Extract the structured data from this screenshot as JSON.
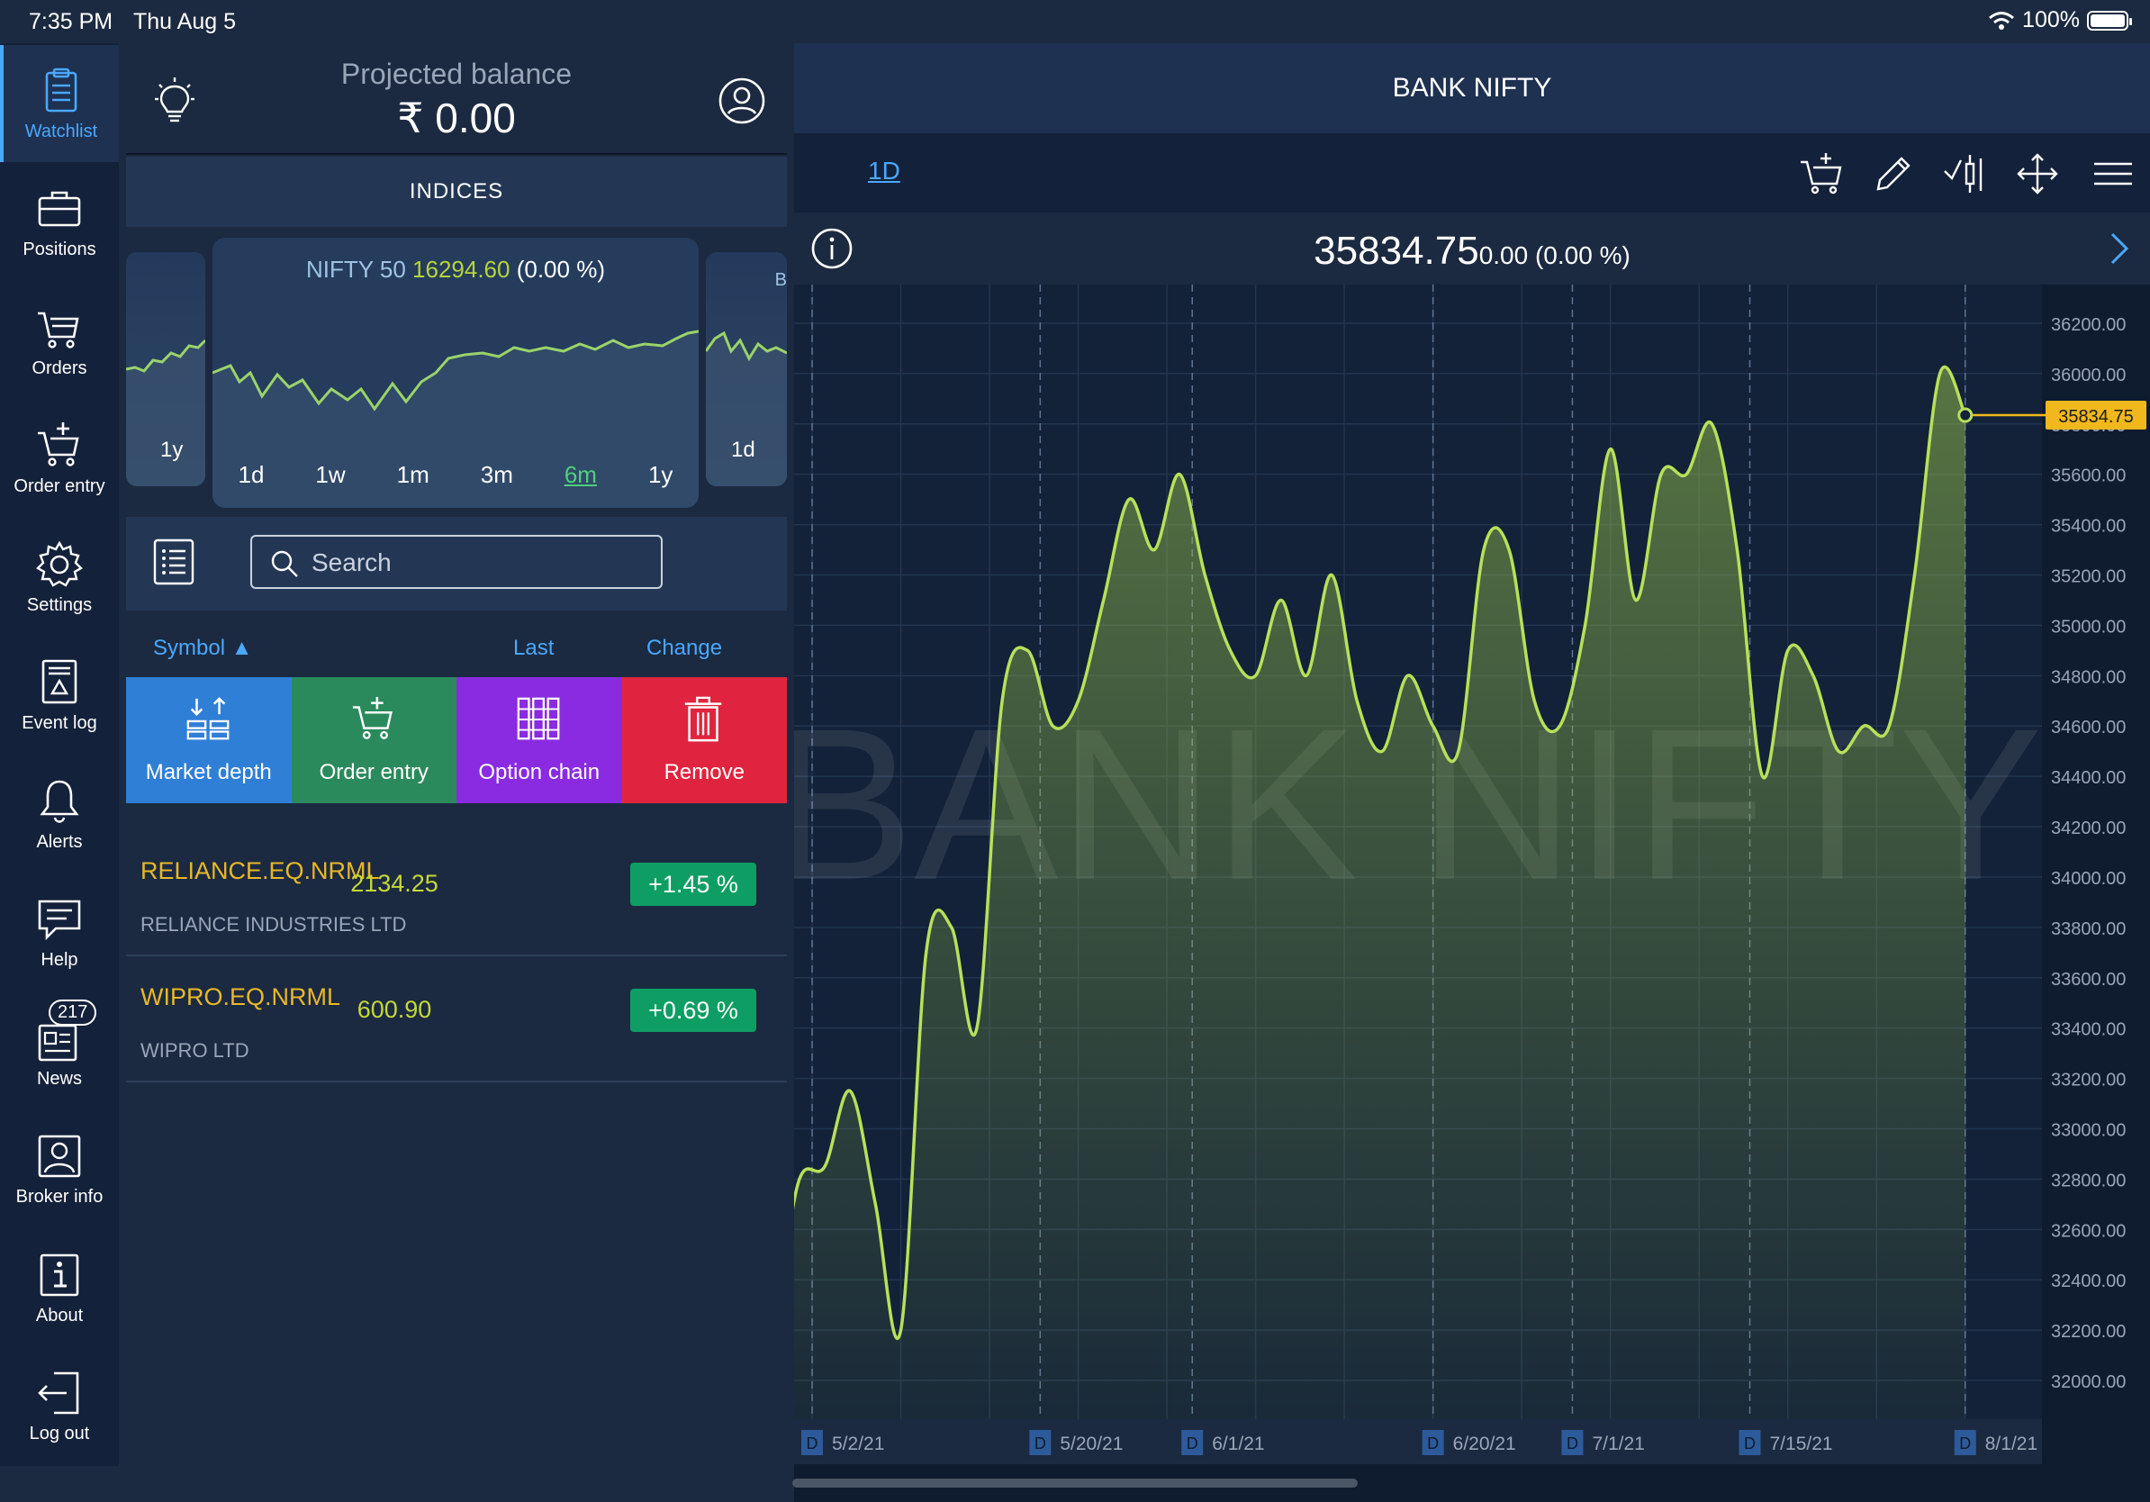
{
  "status_bar": {
    "time": "7:35 PM",
    "date": "Thu Aug 5",
    "battery": "100%"
  },
  "nav": [
    {
      "label": "Watchlist",
      "icon": "watchlist-icon",
      "active": true
    },
    {
      "label": "Positions",
      "icon": "briefcase-icon"
    },
    {
      "label": "Orders",
      "icon": "cart-icon"
    },
    {
      "label": "Order entry",
      "icon": "cart-plus-icon"
    },
    {
      "label": "Settings",
      "icon": "gear-icon"
    },
    {
      "label": "Event log",
      "icon": "event-log-icon"
    },
    {
      "label": "Alerts",
      "icon": "bell-icon"
    },
    {
      "label": "Help",
      "icon": "help-chat-icon"
    },
    {
      "label": "News",
      "icon": "news-icon",
      "badge": "217"
    },
    {
      "label": "Broker info",
      "icon": "broker-icon"
    },
    {
      "label": "About",
      "icon": "info-icon"
    },
    {
      "label": "Log out",
      "icon": "logout-icon"
    }
  ],
  "header": {
    "projected_label": "Projected balance",
    "projected_value": "₹ 0.00"
  },
  "indices": {
    "title": "INDICES",
    "left_card_range": "1y",
    "right_card_range": "1d",
    "right_card_title": "B",
    "main": {
      "name": "NIFTY 50",
      "value": "16294.60",
      "change": "(0.00 %)",
      "ranges": [
        "1d",
        "1w",
        "1m",
        "3m",
        "6m",
        "1y"
      ],
      "selected_range": "6m"
    }
  },
  "search": {
    "placeholder": "Search"
  },
  "columns": {
    "symbol": "Symbol ▲",
    "last": "Last",
    "change": "Change"
  },
  "actions": [
    {
      "label": "Market depth",
      "icon": "market-depth-icon",
      "color": "#2f7fd6"
    },
    {
      "label": "Order entry",
      "icon": "cart-plus-icon",
      "color": "#2b8a5c"
    },
    {
      "label": "Option chain",
      "icon": "option-chain-icon",
      "color": "#8a2be2"
    },
    {
      "label": "Remove",
      "icon": "trash-icon",
      "color": "#e0243f"
    }
  ],
  "rows": [
    {
      "symbol": "RELIANCE.EQ.NRML",
      "name": "RELIANCE INDUSTRIES LTD",
      "last": "2134.25",
      "change": "+1.45 %"
    },
    {
      "symbol": "WIPRO.EQ.NRML",
      "name": "WIPRO LTD",
      "last": "600.90",
      "change": "+0.69 %"
    }
  ],
  "chart": {
    "title": "BANK NIFTY",
    "timeframe": "1D",
    "price": "35834.75",
    "change": "0.00 (0.00 %)",
    "watermark": "BANK NIFTY",
    "last_label": "35834.75"
  },
  "chart_data": {
    "type": "area",
    "title": "BANK NIFTY",
    "ylim": [
      31900,
      36300
    ],
    "y_ticks": [
      32000,
      32200,
      32400,
      32600,
      32800,
      33000,
      33200,
      33400,
      33600,
      33800,
      34000,
      34200,
      34400,
      34600,
      34800,
      35000,
      35200,
      35400,
      35600,
      35800,
      36000,
      36200
    ],
    "y_tick_labels": [
      "32000.00",
      "32200.00",
      "32400.00",
      "32600.00",
      "32800.00",
      "33000.00",
      "33200.00",
      "33400.00",
      "33600.00",
      "33800.00",
      "34000.00",
      "34200.00",
      "34400.00",
      "34600.00",
      "34800.00",
      "35000.00",
      "35200.00",
      "35400.00",
      "35600.00",
      "35800.00",
      "36000.00",
      "36200.00"
    ],
    "x_tick_labels": [
      "5/2/21",
      "5/20/21",
      "6/1/21",
      "6/20/21",
      "7/1/21",
      "7/15/21",
      "8/1/21"
    ],
    "x_tick_days": [
      0,
      18,
      30,
      49,
      60,
      74,
      91
    ],
    "x_range_days": [
      0,
      97
    ],
    "series": [
      {
        "values": [
          [
            -5,
            32400
          ],
          [
            -3,
            32300
          ],
          [
            -1,
            32800
          ],
          [
            1,
            32850
          ],
          [
            3,
            33150
          ],
          [
            5,
            32700
          ],
          [
            7,
            32200
          ],
          [
            9,
            33700
          ],
          [
            11,
            33800
          ],
          [
            13,
            33400
          ],
          [
            15,
            34700
          ],
          [
            17,
            34900
          ],
          [
            19,
            34600
          ],
          [
            21,
            34700
          ],
          [
            23,
            35100
          ],
          [
            25,
            35500
          ],
          [
            27,
            35300
          ],
          [
            29,
            35600
          ],
          [
            31,
            35200
          ],
          [
            33,
            34900
          ],
          [
            35,
            34800
          ],
          [
            37,
            35100
          ],
          [
            39,
            34800
          ],
          [
            41,
            35200
          ],
          [
            43,
            34700
          ],
          [
            45,
            34500
          ],
          [
            47,
            34800
          ],
          [
            49,
            34600
          ],
          [
            51,
            34500
          ],
          [
            53,
            35300
          ],
          [
            55,
            35300
          ],
          [
            57,
            34700
          ],
          [
            59,
            34600
          ],
          [
            61,
            35000
          ],
          [
            63,
            35700
          ],
          [
            65,
            35100
          ],
          [
            67,
            35600
          ],
          [
            69,
            35600
          ],
          [
            71,
            35800
          ],
          [
            73,
            35300
          ],
          [
            75,
            34400
          ],
          [
            77,
            34900
          ],
          [
            79,
            34800
          ],
          [
            81,
            34500
          ],
          [
            83,
            34600
          ],
          [
            85,
            34600
          ],
          [
            87,
            35200
          ],
          [
            89,
            36000
          ],
          [
            91,
            35834.75
          ]
        ]
      }
    ],
    "color": "#b8e05a",
    "grid": true,
    "day_markers": [
      "5/2/21",
      "5/20/21",
      "6/1/21",
      "6/20/21",
      "7/1/21",
      "7/15/21",
      "8/1/21"
    ]
  }
}
